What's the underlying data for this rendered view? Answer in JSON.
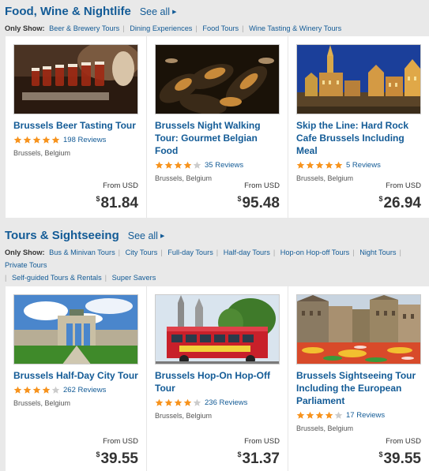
{
  "sections": [
    {
      "title": "Food, Wine & Nightlife",
      "see_all": "See all",
      "only_show": "Only Show:",
      "filters": [
        "Beer & Brewery Tours",
        "Dining Experiences",
        "Food Tours",
        "Wine Tasting & Winery Tours"
      ],
      "cards": [
        {
          "title": "Brussels Beer Tasting Tour",
          "rating": 5,
          "reviews": "198 Reviews",
          "location": "Brussels, Belgium",
          "from": "From USD",
          "currency": "$",
          "price": "81.84",
          "image": "beer-glasses-image"
        },
        {
          "title": "Brussels Night Walking Tour: Gourmet Belgian Food",
          "rating": 4,
          "reviews": "35 Reviews",
          "location": "Brussels, Belgium",
          "from": "From USD",
          "currency": "$",
          "price": "95.48",
          "image": "mussels-image"
        },
        {
          "title": "Skip the Line: Hard Rock Cafe Brussels Including Meal",
          "rating": 5,
          "reviews": "5 Reviews",
          "location": "Brussels, Belgium",
          "from": "From USD",
          "currency": "$",
          "price": "26.94",
          "image": "grand-place-night-image"
        }
      ]
    },
    {
      "title": "Tours & Sightseeing",
      "see_all": "See all",
      "only_show": "Only Show:",
      "filters": [
        "Bus & Minivan Tours",
        "City Tours",
        "Full-day Tours",
        "Half-day Tours",
        "Hop-on Hop-off Tours",
        "Night Tours",
        "Private Tours",
        "Self-guided Tours & Rentals",
        "Super Savers"
      ],
      "cards": [
        {
          "title": "Brussels Half-Day City Tour",
          "rating": 4,
          "reviews": "262 Reviews",
          "location": "Brussels, Belgium",
          "from": "From USD",
          "currency": "$",
          "price": "39.55",
          "image": "cinquantenaire-arch-image"
        },
        {
          "title": "Brussels Hop-On Hop-Off Tour",
          "rating": 4,
          "reviews": "236 Reviews",
          "location": "Brussels, Belgium",
          "from": "From USD",
          "currency": "$",
          "price": "31.37",
          "image": "red-bus-image"
        },
        {
          "title": "Brussels Sightseeing Tour Including the European Parliament",
          "rating": 4,
          "reviews": "17 Reviews",
          "location": "Brussels, Belgium",
          "from": "From USD",
          "currency": "$",
          "price": "39.55",
          "image": "flower-carpet-image"
        }
      ]
    }
  ],
  "colors": {
    "link": "#135b96",
    "star_on": "#f7931d",
    "star_off": "#cccccc"
  }
}
